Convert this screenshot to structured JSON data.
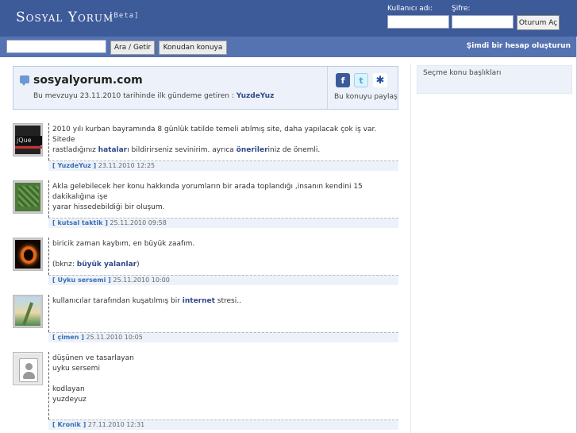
{
  "header": {
    "logo": "Sosyal Yorum",
    "beta": "[Beta]",
    "username_label": "Kullanıcı adı:",
    "password_label": "Şifre:",
    "login_button": "Oturum Aç"
  },
  "searchbar": {
    "search_button": "Ara / Getir",
    "topic_button": "Konudan konuya",
    "signup_link": "Şimdi bir hesap oluşturun"
  },
  "topic": {
    "title": "sosyalyorum.com",
    "subtitle_prefix": "Bu mevzuyu 23.11.2010 tarihinde ilk gündeme getiren :",
    "subtitle_author": "YuzdeYuz",
    "share_label": "Bu konuyu paylaş"
  },
  "sidebar": {
    "title": "Seçme konu başlıkları"
  },
  "icons": {
    "facebook": "facebook-icon",
    "twitter": "twitter-icon",
    "myspace": "myspace-icon"
  },
  "colors": {
    "header_bg": "#3d5a99",
    "searchbar_bg": "#5573b1",
    "link": "#2e4a8a",
    "meta_author": "#3a6fb3",
    "panel_bg": "#edf2fa"
  },
  "entries": [
    {
      "line1_a": "2010 yılı kurban bayramında 8 günlük tatilde temeli atılmış site, daha yapılacak çok iş var. Sitede",
      "line2_a": "rastladığınız ",
      "link1": "hatalar",
      "line2_b": "ı bildirirseniz sevinirim. ayrıca ",
      "link2": "öneriler",
      "line2_c": "iniz de önemli.",
      "author": "YuzdeYuz",
      "date": "23.11.2010 12:25"
    },
    {
      "line1_a": "Akla gelebilecek her konu hakkında yorumların bir arada toplandığı ,insanın kendini 15 dakikalığına işe",
      "line2_a": "yarar hissedebildiği bir oluşum.",
      "author": "kutsal taktik",
      "date": "25.11.2010 09:58"
    },
    {
      "line1_a": "biricik zaman kaybım, en büyük zaafım.",
      "line2_a": "(bknz: ",
      "link1": "büyük yalanlar",
      "line2_b": ")",
      "author": "Uyku sersemi",
      "date": "25.11.2010 10:00"
    },
    {
      "line1_a": "kullanıcılar tarafından kuşatılmış bir ",
      "link1": "internet",
      "line1_b": " stresi..",
      "author": "çimen",
      "date": "25.11.2010 10:05"
    },
    {
      "lines": [
        "düşünen ve tasarlayan",
        "uyku sersemi",
        "",
        "kodlayan",
        "yuzdeyuz"
      ],
      "author": "Kronik",
      "date": "27.11.2010 12:31"
    }
  ]
}
